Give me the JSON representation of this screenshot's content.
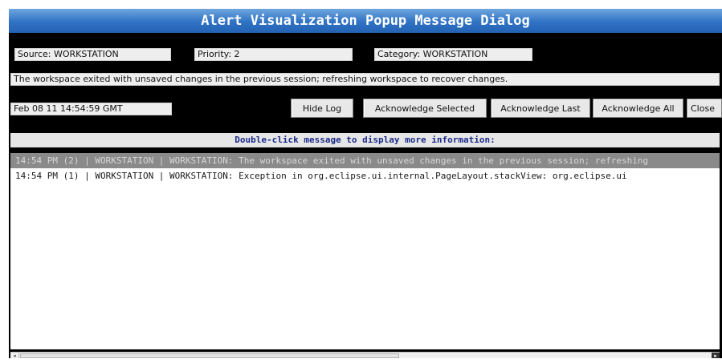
{
  "title": "Alert Visualization Popup Message Dialog",
  "fields": {
    "source": "Source: WORKSTATION",
    "priority": "Priority: 2",
    "category": "Category: WORKSTATION",
    "message": "The workspace exited with unsaved changes in the previous session; refreshing workspace to recover changes.",
    "timestamp": "Feb 08 11 14:54:59 GMT"
  },
  "buttons": {
    "hide_log": "Hide Log",
    "ack_selected": "Acknowledge Selected",
    "ack_last": "Acknowledge Last",
    "ack_all": "Acknowledge All",
    "close": "Close"
  },
  "hint": "Double-click message to display more information:",
  "log": [
    "14:54 PM (2) | WORKSTATION | WORKSTATION: The workspace exited with unsaved changes in the previous session; refreshing",
    "14:54 PM (1) | WORKSTATION | WORKSTATION: Exception in org.eclipse.ui.internal.PageLayout.stackView: org.eclipse.ui"
  ],
  "scroll": {
    "thumb_fraction": 0.55
  },
  "colors": {
    "title_bg": "#2f72c4",
    "window_bg": "#000000",
    "selected_row_bg": "#8a8a8a",
    "hint_text": "#1c2a8a"
  }
}
